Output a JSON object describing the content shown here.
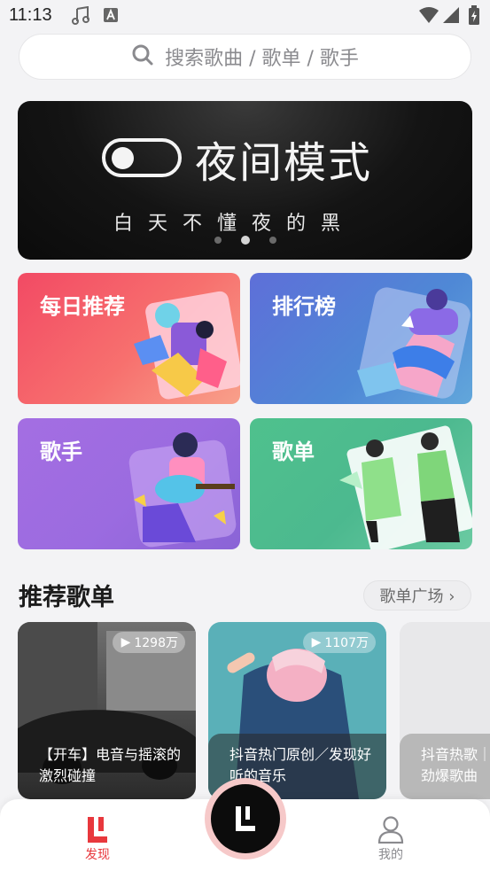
{
  "status_bar": {
    "time": "11:13"
  },
  "search": {
    "placeholder": "搜索歌曲 / 歌单 / 歌手"
  },
  "banner": {
    "title": "夜间模式",
    "subtitle": "白天不懂夜的黑",
    "slide_count": 3,
    "active_slide": 2
  },
  "categories": [
    {
      "label": "每日推荐",
      "color": "#f0566a"
    },
    {
      "label": "排行榜",
      "color": "#4f7fd6"
    },
    {
      "label": "歌手",
      "color": "#9b6be0"
    },
    {
      "label": "歌单",
      "color": "#4fbf8e"
    }
  ],
  "recommend": {
    "title": "推荐歌单",
    "more_label": "歌单广场 ›",
    "playlists": [
      {
        "count": "1298万",
        "title": "【开车】电音与摇滚的激烈碰撞"
      },
      {
        "count": "1107万",
        "title": "抖音热门原创／发现好听的音乐"
      },
      {
        "count": "",
        "title": "抖音热歌｜劲爆歌曲"
      }
    ]
  },
  "bottom_nav": {
    "discover_label": "发现",
    "mine_label": "我的",
    "accent": "#e8383d"
  }
}
